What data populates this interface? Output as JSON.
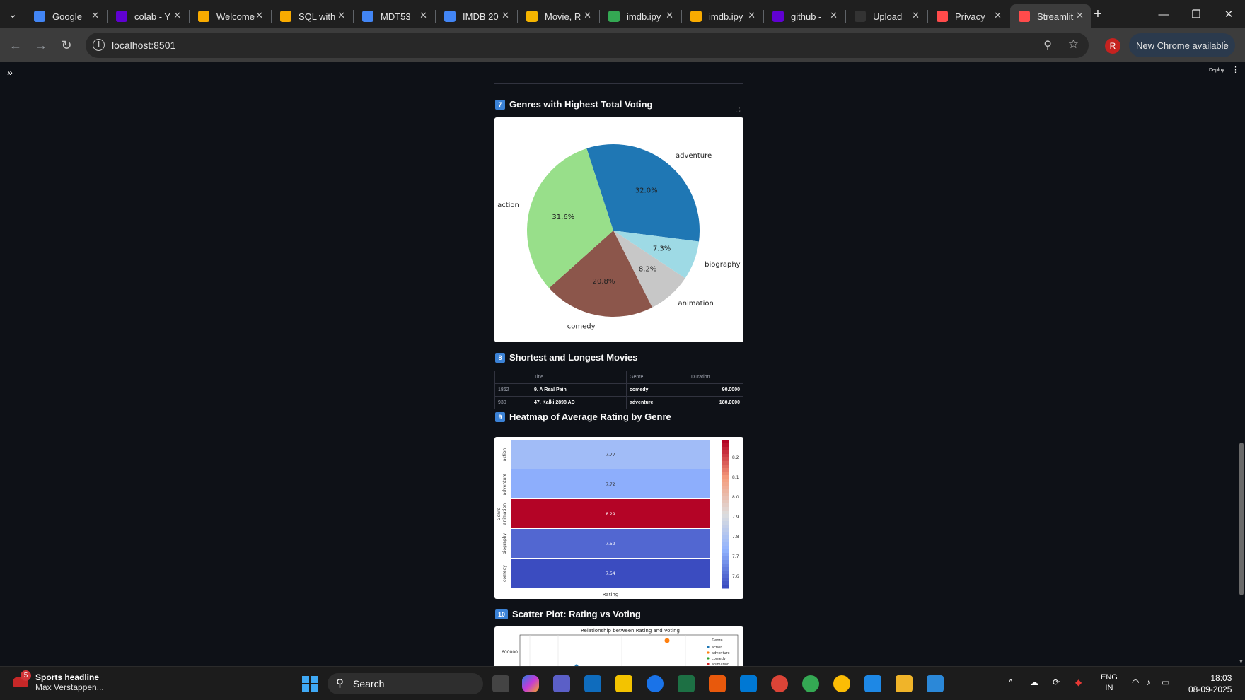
{
  "browser": {
    "tabs": [
      {
        "title": "Google",
        "icon": "google-icon",
        "color": "#4285f4"
      },
      {
        "title": "colab - Y",
        "icon": "yahoo-icon",
        "color": "#6001d2"
      },
      {
        "title": "Welcome",
        "icon": "colab-icon",
        "color": "#f9ab00"
      },
      {
        "title": "SQL with",
        "icon": "colab-icon",
        "color": "#f9ab00"
      },
      {
        "title": "MDT53",
        "icon": "docs-icon",
        "color": "#4285f4"
      },
      {
        "title": "IMDB 20",
        "icon": "docs-icon",
        "color": "#4285f4"
      },
      {
        "title": "Movie, R",
        "icon": "slides-icon",
        "color": "#f4b400"
      },
      {
        "title": "imdb.ipy",
        "icon": "drive-icon",
        "color": "#34a853"
      },
      {
        "title": "imdb.ipy",
        "icon": "colab-icon",
        "color": "#f9ab00"
      },
      {
        "title": "github -",
        "icon": "yahoo-icon",
        "color": "#6001d2"
      },
      {
        "title": "Upload",
        "icon": "github-icon",
        "color": "#333333"
      },
      {
        "title": "Privacy",
        "icon": "streamlit-icon",
        "color": "#ff4b4b"
      },
      {
        "title": "Streamlit",
        "icon": "streamlit-icon",
        "color": "#ff4b4b"
      }
    ],
    "active_tab": 12,
    "url": "localhost:8501",
    "profile_initial": "R",
    "update_label": "New Chrome available"
  },
  "app": {
    "deploy_label": "Deploy",
    "sections": {
      "genres_voting": {
        "num": "7",
        "title": "Genres with Highest Total Voting"
      },
      "short_long": {
        "num": "8",
        "title": "Shortest and Longest Movies"
      },
      "heatmap": {
        "num": "9",
        "title": "Heatmap of Average Rating by Genre"
      },
      "scatter": {
        "num": "10",
        "title": "Scatter Plot: Rating vs Voting"
      }
    },
    "table": {
      "columns": [
        "",
        "Title",
        "Genre",
        "Duration"
      ],
      "rows": [
        {
          "idx": "1862",
          "title": "9.  A Real Pain",
          "genre": "comedy",
          "duration": "90.0000"
        },
        {
          "idx": "930",
          "title": "47.  Kalki 2898 AD",
          "genre": "adventure",
          "duration": "180.0000"
        }
      ]
    }
  },
  "chart_data": [
    {
      "type": "pie",
      "labels": [
        "adventure",
        "biography",
        "animation",
        "comedy",
        "action"
      ],
      "values": [
        32.0,
        7.3,
        8.2,
        20.8,
        31.6
      ],
      "value_labels": [
        "32.0%",
        "7.3%",
        "8.2%",
        "20.8%",
        "31.6%"
      ],
      "colors": [
        "#1f77b4",
        "#9edae5",
        "#c7c7c7",
        "#8c564b",
        "#98df8a"
      ]
    },
    {
      "type": "heatmap",
      "ylabel": "Genre",
      "xlabel": "Rating",
      "categories": [
        "action",
        "adventure",
        "animation",
        "biography",
        "comedy"
      ],
      "values": [
        7.77,
        7.72,
        8.29,
        7.59,
        7.54
      ],
      "value_labels": [
        "7.77",
        "7.72",
        "8.29",
        "7.59",
        "7.54"
      ],
      "colorbar_ticks": [
        "8.2",
        "8.1",
        "8.0",
        "7.9",
        "7.8",
        "7.7",
        "7.6"
      ],
      "colormap": "coolwarm"
    },
    {
      "type": "scatter",
      "title": "Relationship between Rating and Voting",
      "ytick": "600000",
      "legend_title": "Genre",
      "legend": [
        "action",
        "adventure",
        "comedy",
        "animation"
      ],
      "legend_colors": [
        "#1f77b4",
        "#ff7f0e",
        "#2ca02c",
        "#d62728"
      ]
    }
  ],
  "taskbar": {
    "news_badge": "5",
    "news_title": "Sports headline",
    "news_sub": "Max Verstappen...",
    "search_label": "Search",
    "lang_1": "ENG",
    "lang_2": "IN",
    "time": "18:03",
    "date": "08-09-2025"
  }
}
